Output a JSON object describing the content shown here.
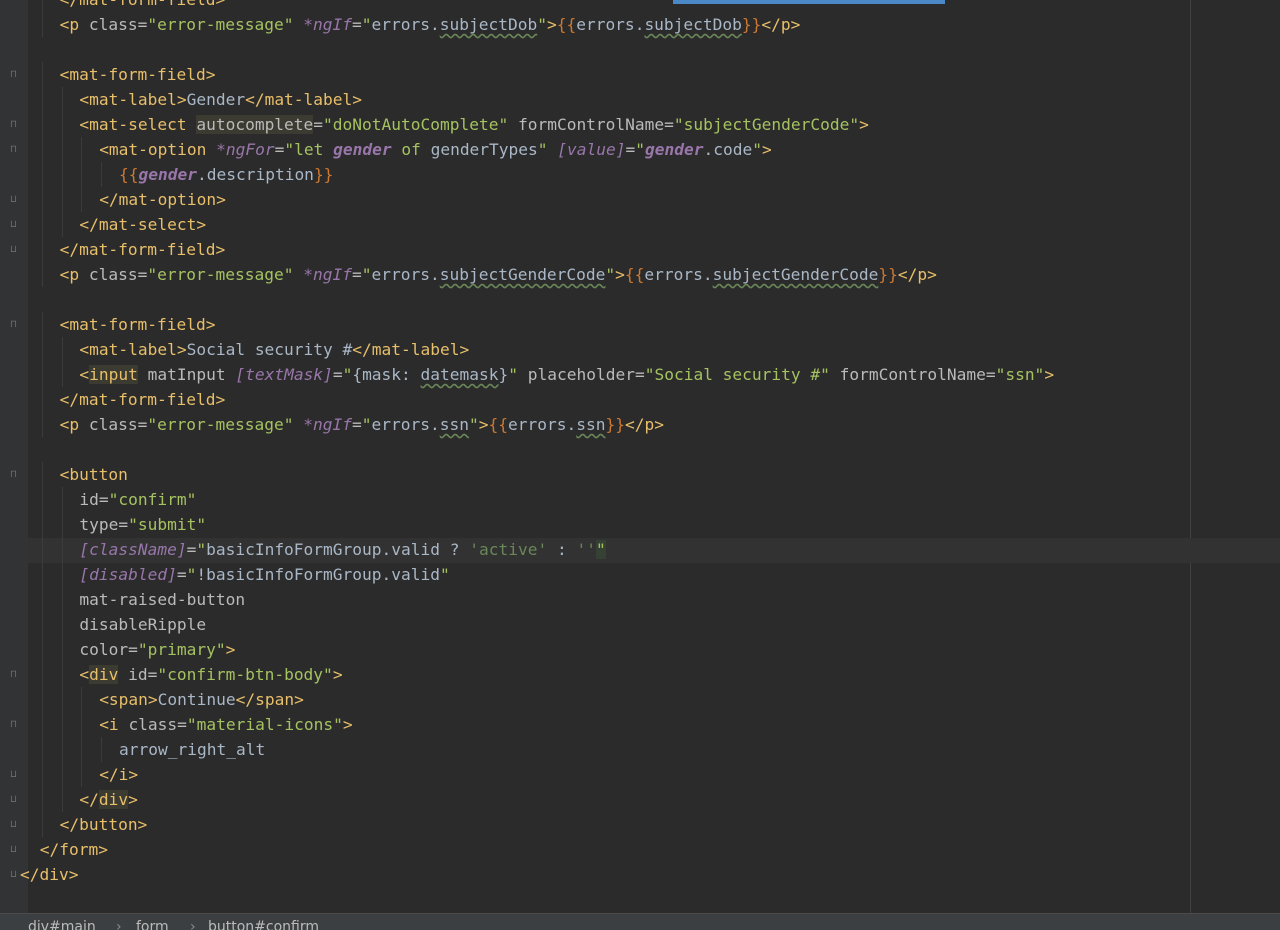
{
  "editor": {
    "lines": [
      {
        "indent": 2,
        "fold": "",
        "tokens": [
          {
            "t": "</mat-form-field>",
            "c": "tg"
          }
        ]
      },
      {
        "indent": 2,
        "fold": "",
        "tokens": [
          {
            "t": "<p ",
            "c": "tg"
          },
          {
            "t": "class=",
            "c": "at"
          },
          {
            "t": "\"error-message\"",
            "c": "sv"
          },
          {
            "t": " ",
            "c": "bd"
          },
          {
            "t": "*ngIf",
            "c": "ng"
          },
          {
            "t": "=",
            "c": "at"
          },
          {
            "t": "\"",
            "c": "sv"
          },
          {
            "t": "errors",
            "c": "bd"
          },
          {
            "t": ".",
            "c": "bd"
          },
          {
            "t": "subjectDob",
            "c": "bd warn"
          },
          {
            "t": "\"",
            "c": "sv"
          },
          {
            "t": ">",
            "c": "tg"
          },
          {
            "t": "{{",
            "c": "br"
          },
          {
            "t": "errors",
            "c": "bd"
          },
          {
            "t": ".",
            "c": "bd"
          },
          {
            "t": "subjectDob",
            "c": "bd warn"
          },
          {
            "t": "}}",
            "c": "br"
          },
          {
            "t": "</p>",
            "c": "tg"
          }
        ]
      },
      {
        "indent": 0,
        "fold": "",
        "tokens": []
      },
      {
        "indent": 2,
        "fold": "open",
        "tokens": [
          {
            "t": "<mat-form-field>",
            "c": "tg"
          }
        ]
      },
      {
        "indent": 3,
        "fold": "",
        "tokens": [
          {
            "t": "<mat-label>",
            "c": "tg"
          },
          {
            "t": "Gender",
            "c": "bd"
          },
          {
            "t": "</mat-label>",
            "c": "tg"
          }
        ]
      },
      {
        "indent": 3,
        "fold": "open",
        "tokens": [
          {
            "t": "<mat-select ",
            "c": "tg"
          },
          {
            "t": "autocomplete",
            "c": "at hl2"
          },
          {
            "t": "=",
            "c": "at"
          },
          {
            "t": "\"doNotAutoComplete\"",
            "c": "sv"
          },
          {
            "t": " formControlName=",
            "c": "at"
          },
          {
            "t": "\"subjectGenderCode\"",
            "c": "sv"
          },
          {
            "t": ">",
            "c": "tg"
          }
        ]
      },
      {
        "indent": 4,
        "fold": "open",
        "tokens": [
          {
            "t": "<mat-option ",
            "c": "tg"
          },
          {
            "t": "*ngFor",
            "c": "ng"
          },
          {
            "t": "=",
            "c": "at"
          },
          {
            "t": "\"",
            "c": "sv"
          },
          {
            "t": "let ",
            "c": "sv"
          },
          {
            "t": "gender",
            "c": "pv"
          },
          {
            "t": " of ",
            "c": "sv"
          },
          {
            "t": "genderTypes",
            "c": "bd"
          },
          {
            "t": "\"",
            "c": "sv"
          },
          {
            "t": " [value]",
            "c": "ng"
          },
          {
            "t": "=",
            "c": "at"
          },
          {
            "t": "\"",
            "c": "sv"
          },
          {
            "t": "gender",
            "c": "pv"
          },
          {
            "t": ".code",
            "c": "bd"
          },
          {
            "t": "\"",
            "c": "sv"
          },
          {
            "t": ">",
            "c": "tg"
          }
        ]
      },
      {
        "indent": 5,
        "fold": "",
        "tokens": [
          {
            "t": "{{",
            "c": "br"
          },
          {
            "t": "gender",
            "c": "pv"
          },
          {
            "t": ".description",
            "c": "bd"
          },
          {
            "t": "}}",
            "c": "br"
          }
        ]
      },
      {
        "indent": 4,
        "fold": "close",
        "tokens": [
          {
            "t": "</mat-option>",
            "c": "tg"
          }
        ]
      },
      {
        "indent": 3,
        "fold": "close",
        "tokens": [
          {
            "t": "</mat-select>",
            "c": "tg"
          }
        ]
      },
      {
        "indent": 2,
        "fold": "close",
        "tokens": [
          {
            "t": "</mat-form-field>",
            "c": "tg"
          }
        ]
      },
      {
        "indent": 2,
        "fold": "",
        "tokens": [
          {
            "t": "<p ",
            "c": "tg"
          },
          {
            "t": "class=",
            "c": "at"
          },
          {
            "t": "\"error-message\"",
            "c": "sv"
          },
          {
            "t": " ",
            "c": "bd"
          },
          {
            "t": "*ngIf",
            "c": "ng"
          },
          {
            "t": "=",
            "c": "at"
          },
          {
            "t": "\"",
            "c": "sv"
          },
          {
            "t": "errors",
            "c": "bd"
          },
          {
            "t": ".",
            "c": "bd"
          },
          {
            "t": "subjectGenderCode",
            "c": "bd warn"
          },
          {
            "t": "\"",
            "c": "sv"
          },
          {
            "t": ">",
            "c": "tg"
          },
          {
            "t": "{{",
            "c": "br"
          },
          {
            "t": "errors",
            "c": "bd"
          },
          {
            "t": ".",
            "c": "bd"
          },
          {
            "t": "subjectGenderCode",
            "c": "bd warn"
          },
          {
            "t": "}}",
            "c": "br"
          },
          {
            "t": "</p>",
            "c": "tg"
          }
        ]
      },
      {
        "indent": 0,
        "fold": "",
        "tokens": []
      },
      {
        "indent": 2,
        "fold": "open",
        "tokens": [
          {
            "t": "<mat-form-field>",
            "c": "tg"
          }
        ]
      },
      {
        "indent": 3,
        "fold": "",
        "tokens": [
          {
            "t": "<mat-label>",
            "c": "tg"
          },
          {
            "t": "Social security #",
            "c": "bd"
          },
          {
            "t": "</mat-label>",
            "c": "tg"
          }
        ]
      },
      {
        "indent": 3,
        "fold": "",
        "tokens": [
          {
            "t": "<",
            "c": "tg"
          },
          {
            "t": "input",
            "c": "tg hl2"
          },
          {
            "t": " matInput ",
            "c": "at"
          },
          {
            "t": "[textMask]",
            "c": "ng"
          },
          {
            "t": "=",
            "c": "at"
          },
          {
            "t": "\"",
            "c": "sv"
          },
          {
            "t": "{",
            "c": "bd"
          },
          {
            "t": "mask",
            "c": "bd"
          },
          {
            "t": ": ",
            "c": "bd"
          },
          {
            "t": "datemask",
            "c": "bd warn"
          },
          {
            "t": "}",
            "c": "bd"
          },
          {
            "t": "\"",
            "c": "sv"
          },
          {
            "t": " placeholder=",
            "c": "at"
          },
          {
            "t": "\"Social security #\"",
            "c": "sv"
          },
          {
            "t": " formControlName=",
            "c": "at"
          },
          {
            "t": "\"ssn\"",
            "c": "sv"
          },
          {
            "t": ">",
            "c": "tg"
          }
        ]
      },
      {
        "indent": 2,
        "fold": "",
        "tokens": [
          {
            "t": "</mat-form-field>",
            "c": "tg"
          }
        ]
      },
      {
        "indent": 2,
        "fold": "",
        "tokens": [
          {
            "t": "<p ",
            "c": "tg"
          },
          {
            "t": "class=",
            "c": "at"
          },
          {
            "t": "\"error-message\"",
            "c": "sv"
          },
          {
            "t": " ",
            "c": "bd"
          },
          {
            "t": "*ngIf",
            "c": "ng"
          },
          {
            "t": "=",
            "c": "at"
          },
          {
            "t": "\"",
            "c": "sv"
          },
          {
            "t": "errors",
            "c": "bd"
          },
          {
            "t": ".",
            "c": "bd"
          },
          {
            "t": "ssn",
            "c": "bd warn"
          },
          {
            "t": "\"",
            "c": "sv"
          },
          {
            "t": ">",
            "c": "tg"
          },
          {
            "t": "{{",
            "c": "br"
          },
          {
            "t": "errors",
            "c": "bd"
          },
          {
            "t": ".",
            "c": "bd"
          },
          {
            "t": "ssn",
            "c": "bd warn"
          },
          {
            "t": "}}",
            "c": "br"
          },
          {
            "t": "</p>",
            "c": "tg"
          }
        ]
      },
      {
        "indent": 0,
        "fold": "",
        "tokens": []
      },
      {
        "indent": 2,
        "fold": "open",
        "tokens": [
          {
            "t": "<button",
            "c": "tg"
          }
        ]
      },
      {
        "indent": 3,
        "fold": "",
        "tokens": [
          {
            "t": "id=",
            "c": "at"
          },
          {
            "t": "\"confirm\"",
            "c": "sv"
          }
        ]
      },
      {
        "indent": 3,
        "fold": "",
        "tokens": [
          {
            "t": "type=",
            "c": "at"
          },
          {
            "t": "\"submit\"",
            "c": "sv"
          }
        ]
      },
      {
        "indent": 3,
        "fold": "",
        "tokens": [
          {
            "t": "[className]",
            "c": "ng"
          },
          {
            "t": "=",
            "c": "at"
          },
          {
            "t": "\"",
            "c": "sv"
          },
          {
            "t": "basicInfoFormGroup.valid ? ",
            "c": "bd"
          },
          {
            "t": "'active'",
            "c": "sq"
          },
          {
            "t": " : ",
            "c": "bd"
          },
          {
            "t": "''",
            "c": "sq"
          },
          {
            "t": "\"",
            "c": "sv hl"
          }
        ]
      },
      {
        "indent": 3,
        "fold": "",
        "tokens": [
          {
            "t": "[disabled]",
            "c": "ng"
          },
          {
            "t": "=",
            "c": "at"
          },
          {
            "t": "\"",
            "c": "sv"
          },
          {
            "t": "!basicInfoFormGroup.valid",
            "c": "bd"
          },
          {
            "t": "\"",
            "c": "sv"
          }
        ]
      },
      {
        "indent": 3,
        "fold": "",
        "tokens": [
          {
            "t": "mat-raised-button",
            "c": "at"
          }
        ]
      },
      {
        "indent": 3,
        "fold": "",
        "tokens": [
          {
            "t": "disableRipple",
            "c": "at"
          }
        ]
      },
      {
        "indent": 3,
        "fold": "",
        "tokens": [
          {
            "t": "color=",
            "c": "at"
          },
          {
            "t": "\"primary\"",
            "c": "sv"
          },
          {
            "t": ">",
            "c": "tg"
          }
        ]
      },
      {
        "indent": 3,
        "fold": "open",
        "tokens": [
          {
            "t": "<",
            "c": "tg"
          },
          {
            "t": "div",
            "c": "tg hl2"
          },
          {
            "t": " id=",
            "c": "at"
          },
          {
            "t": "\"confirm-btn-body\"",
            "c": "sv"
          },
          {
            "t": ">",
            "c": "tg"
          }
        ]
      },
      {
        "indent": 4,
        "fold": "",
        "tokens": [
          {
            "t": "<span>",
            "c": "tg"
          },
          {
            "t": "Continue",
            "c": "bd"
          },
          {
            "t": "</span>",
            "c": "tg"
          }
        ]
      },
      {
        "indent": 4,
        "fold": "open",
        "tokens": [
          {
            "t": "<i ",
            "c": "tg"
          },
          {
            "t": "class=",
            "c": "at"
          },
          {
            "t": "\"material-icons\"",
            "c": "sv"
          },
          {
            "t": ">",
            "c": "tg"
          }
        ]
      },
      {
        "indent": 5,
        "fold": "",
        "tokens": [
          {
            "t": "arrow_right_alt",
            "c": "bd"
          }
        ]
      },
      {
        "indent": 4,
        "fold": "close",
        "tokens": [
          {
            "t": "</i>",
            "c": "tg"
          }
        ]
      },
      {
        "indent": 3,
        "fold": "close",
        "tokens": [
          {
            "t": "</",
            "c": "tg"
          },
          {
            "t": "div",
            "c": "tg hl2"
          },
          {
            "t": ">",
            "c": "tg"
          }
        ]
      },
      {
        "indent": 2,
        "fold": "close",
        "tokens": [
          {
            "t": "</button>",
            "c": "tg"
          }
        ]
      },
      {
        "indent": 1,
        "fold": "close",
        "tokens": [
          {
            "t": "</form>",
            "c": "tg"
          }
        ]
      },
      {
        "indent": 0,
        "fold": "close",
        "tokens": [
          {
            "t": "</div>",
            "c": "tg"
          }
        ]
      }
    ]
  },
  "breadcrumb": {
    "items": [
      "div#main",
      "form",
      "button#confirm"
    ],
    "separator": "›"
  },
  "colors": {
    "background": "#2b2b2b",
    "tag": "#e8bf6a",
    "attribute": "#bababa",
    "string": "#a5c261",
    "angular_directive": "#9876aa",
    "brace": "#cc7832",
    "tab_accent": "#4a88c7"
  }
}
